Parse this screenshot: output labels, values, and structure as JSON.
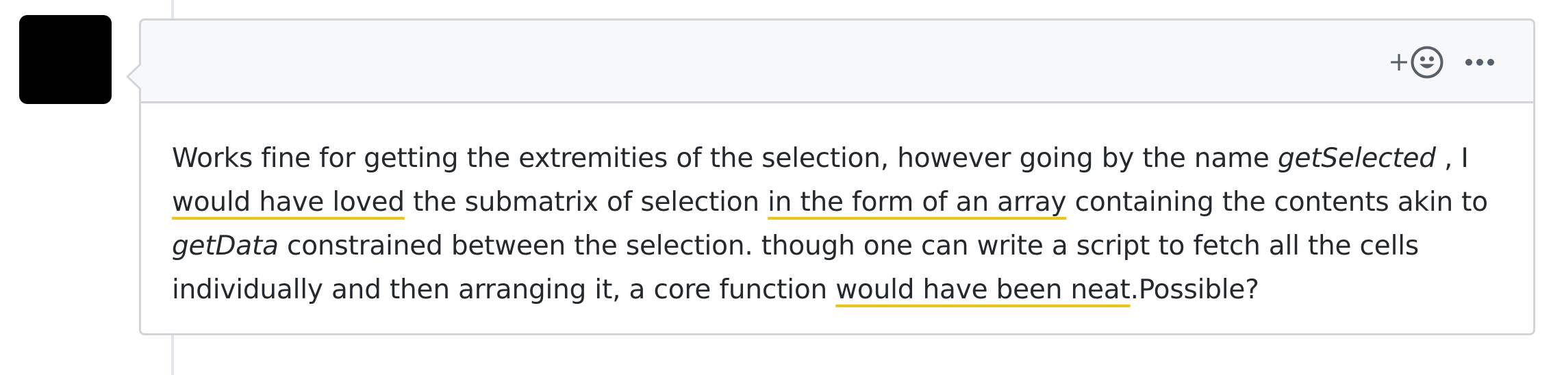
{
  "comment": {
    "body": {
      "s1": "Works fine for getting the extremities of the selection, however going by the name ",
      "em1": "getSelected",
      "s2": " , I ",
      "hl1": "would have loved",
      "s3": " the submatrix of selection ",
      "hl2": "in the form of an array",
      "s4": " containing the contents akin to ",
      "em2": "getData",
      "s5": " constrained between the selection. though one can write a script to fetch all the cells individually and then arranging it, a core function ",
      "hl3": "would have been neat",
      "s6": ".Possible?"
    },
    "actions": {
      "add_reaction_icon": "smiley-icon",
      "plus_glyph": "+",
      "more_icon": "kebab-horizontal-icon"
    }
  },
  "colors": {
    "border": "#d1d5da",
    "header_bg": "#f6f8fa",
    "text": "#24292e",
    "icon": "#586069",
    "highlight_underline": "#f2c40e",
    "avatar": "#000000"
  }
}
